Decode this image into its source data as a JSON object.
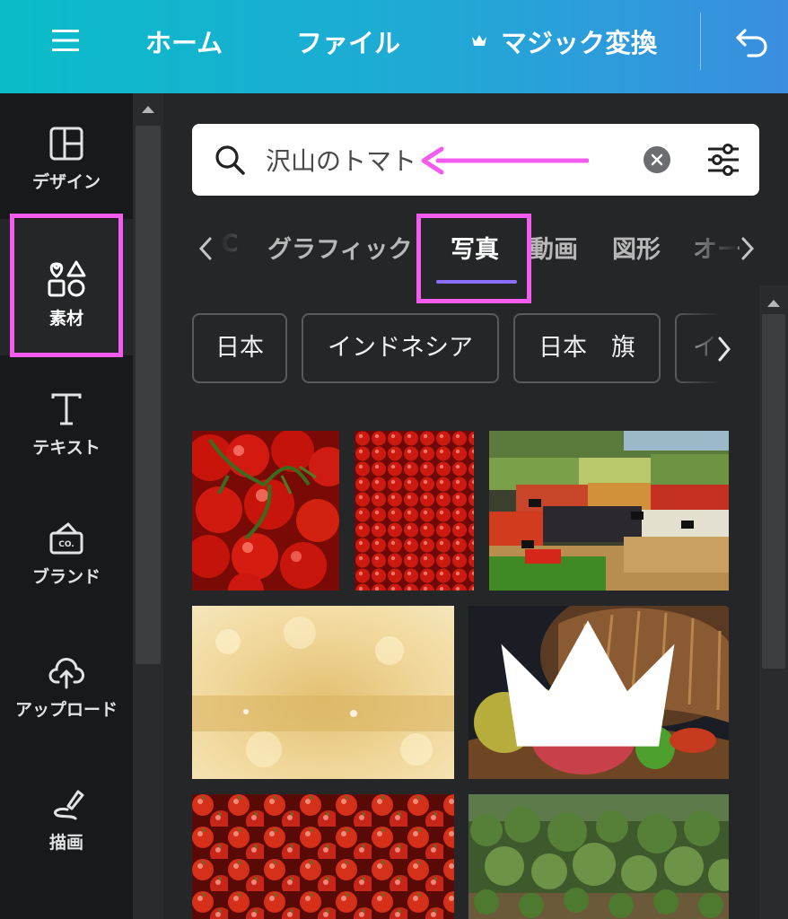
{
  "topbar": {
    "home": "ホーム",
    "file": "ファイル",
    "magic": "マジック変換",
    "menu_icon": "hamburger-icon",
    "undo_icon": "undo-icon"
  },
  "rail": {
    "items": [
      {
        "label": "デザイン",
        "icon": "layout-icon"
      },
      {
        "label": "素材",
        "icon": "elements-icon"
      },
      {
        "label": "テキスト",
        "icon": "text-icon"
      },
      {
        "label": "ブランド",
        "icon": "brand-icon"
      },
      {
        "label": "アップロード",
        "icon": "upload-icon"
      },
      {
        "label": "描画",
        "icon": "draw-icon"
      }
    ],
    "active": "素材"
  },
  "search": {
    "value": "沢山のトマト"
  },
  "tabs": {
    "items": [
      "グラフィック",
      "写真",
      "動画",
      "図形",
      "オー"
    ],
    "partial_left": "C",
    "active": "写真"
  },
  "chips": {
    "items": [
      "日本",
      "インドネシア",
      "日本　旗",
      "イ"
    ]
  },
  "colors": {
    "highlight": "#f45cf0",
    "tab_underline": "#8b6dff",
    "topbar_start": "#09bcc7",
    "topbar_end": "#3b8ee0"
  }
}
